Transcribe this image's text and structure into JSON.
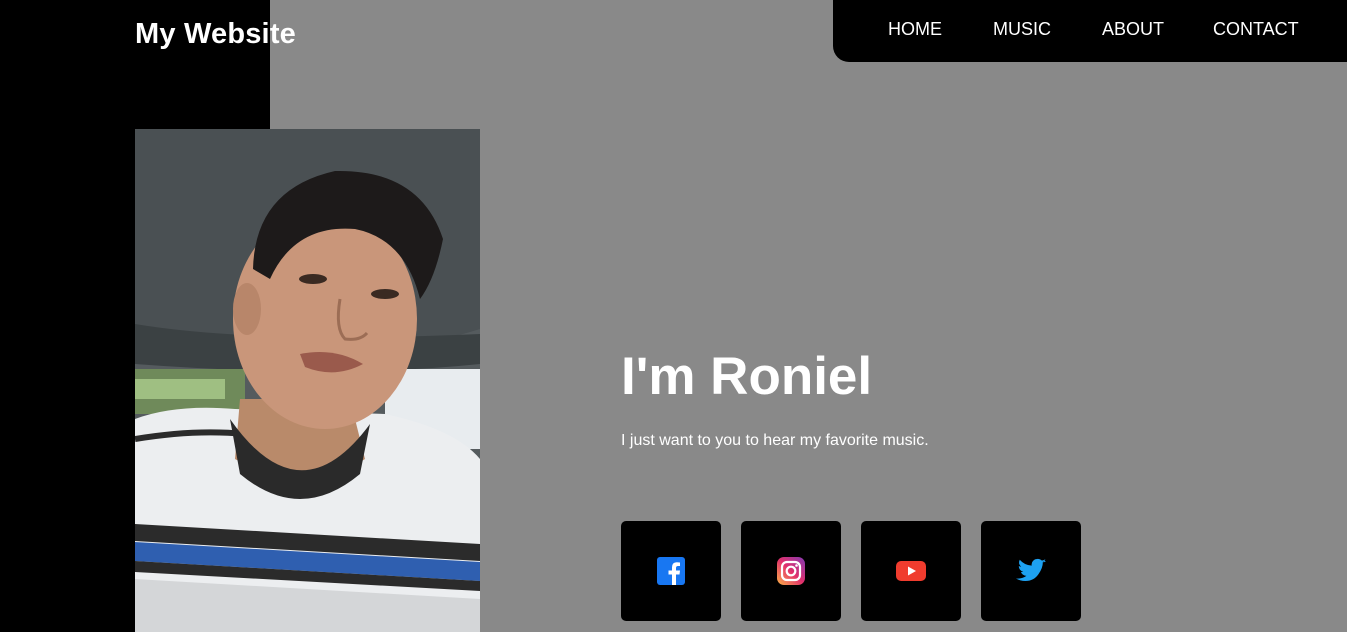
{
  "header": {
    "brand": "My Website",
    "nav": [
      "HOME",
      "MUSIC",
      "ABOUT",
      "CONTACT"
    ]
  },
  "hero": {
    "title": "I'm Roniel",
    "subtitle": "I just want to you to hear my favorite music."
  },
  "social": [
    {
      "icon": "facebook-icon",
      "color": "#1877f2"
    },
    {
      "icon": "instagram-icon",
      "color": "#e1306c"
    },
    {
      "icon": "youtube-icon",
      "color": "#f03c2e"
    },
    {
      "icon": "twitter-icon",
      "color": "#1da1f2"
    }
  ],
  "colors": {
    "background": "#898989",
    "panel": "#000000",
    "text": "#ffffff"
  }
}
